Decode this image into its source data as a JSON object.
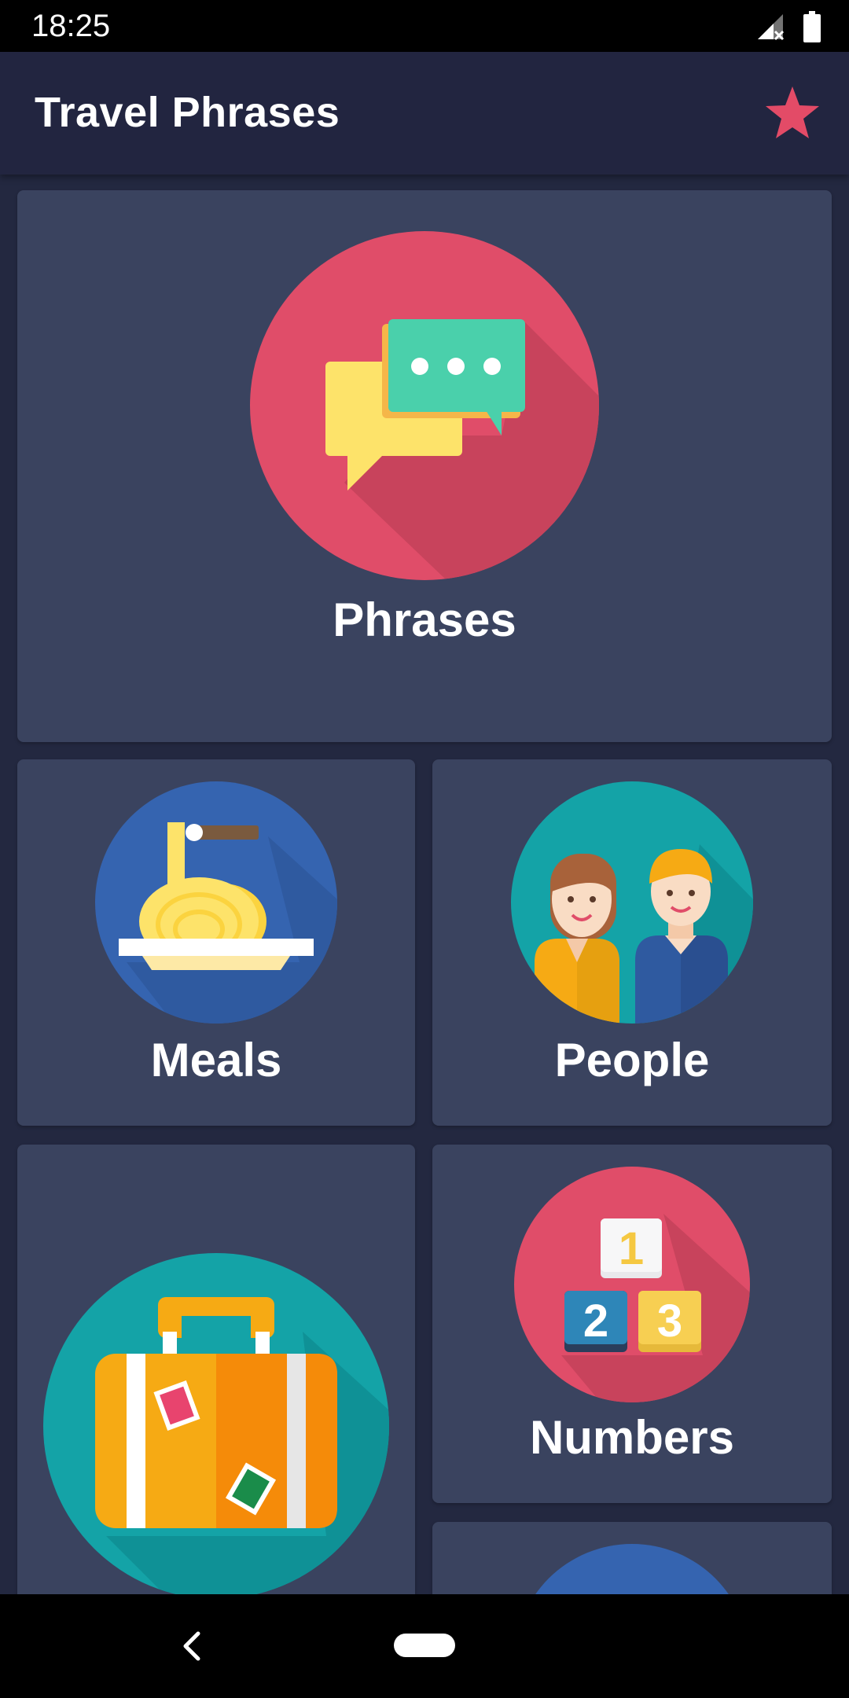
{
  "status_bar": {
    "time": "18:25"
  },
  "app_bar": {
    "title": "Travel Phrases",
    "favorite_icon": "star-icon",
    "accent_color": "#e34b67"
  },
  "categories": [
    {
      "label": "Phrases",
      "icon": "chat-bubbles-icon"
    },
    {
      "label": "Meals",
      "icon": "spaghetti-icon"
    },
    {
      "label": "People",
      "icon": "people-icon"
    },
    {
      "label": "",
      "icon": "suitcase-icon"
    },
    {
      "label": "Numbers",
      "icon": "numbers-icon"
    },
    {
      "label": "",
      "icon": "category-icon"
    }
  ],
  "colors": {
    "background": "#232840",
    "card": "#3a435f",
    "red": "#e04d69",
    "blue": "#3564b0",
    "teal": "#14a3a7"
  }
}
